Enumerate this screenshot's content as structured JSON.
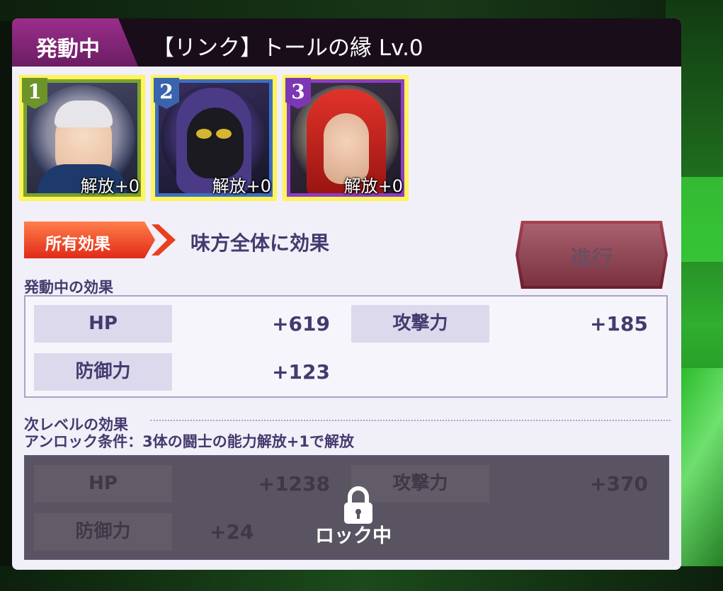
{
  "header": {
    "tab_label": "発動中",
    "title": "【リンク】トールの縁 Lv.0"
  },
  "characters": [
    {
      "number": "1",
      "release": "解放+0",
      "frame_color": "#7aa22e"
    },
    {
      "number": "2",
      "release": "解放+0",
      "frame_color": "#3f6fbf"
    },
    {
      "number": "3",
      "release": "解放+0",
      "frame_color": "#8a3fc2"
    }
  ],
  "effect": {
    "tag": "所有効果",
    "description": "味方全体に効果"
  },
  "proceed_button": {
    "label": "進行"
  },
  "current": {
    "title": "発動中の効果",
    "stats": [
      {
        "label": "HP",
        "value": "+619"
      },
      {
        "label": "攻撃力",
        "value": "+185"
      },
      {
        "label": "防御力",
        "value": "+123"
      }
    ]
  },
  "next": {
    "title": "次レベルの効果",
    "unlock": "アンロック条件：3体の闘士の能力解放+1で解放",
    "stats": [
      {
        "label": "HP",
        "value": "+1238"
      },
      {
        "label": "攻撃力",
        "value": "+370"
      },
      {
        "label": "防御力",
        "value": "+24"
      }
    ],
    "lock_label": "ロック中"
  }
}
